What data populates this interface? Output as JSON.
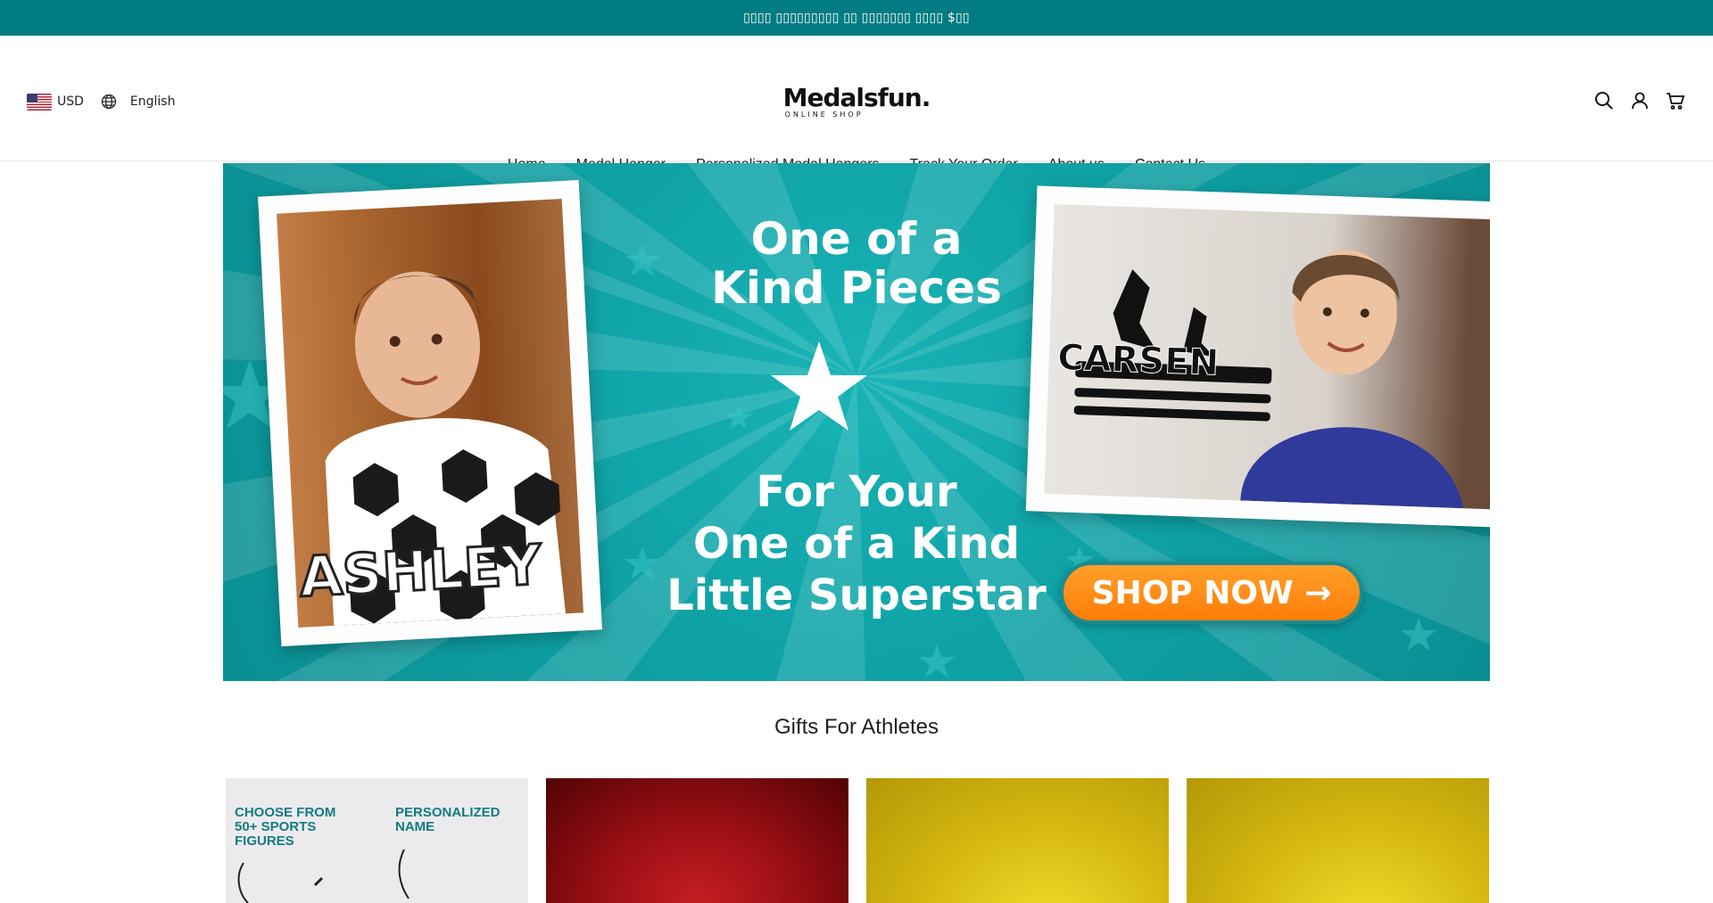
{
  "announcement": {
    "text": "▯▯▯▯ ▯▯▯▯▯▯▯▯▯ ▯▯ ▯▯▯▯▯▯▯ ▯▯▯▯ $▯▯"
  },
  "header": {
    "currency": "USD",
    "language": "English",
    "logo_main": "Medalsfun.",
    "logo_sub": "ONLINE SHOP",
    "icons": [
      "search-icon",
      "account-icon",
      "cart-icon"
    ]
  },
  "nav": {
    "items": [
      {
        "label": "Home"
      },
      {
        "label": "Medal Hanger"
      },
      {
        "label": "Personalized Medal Hangers"
      },
      {
        "label": "Track Your Order"
      },
      {
        "label": "About us"
      },
      {
        "label": "Contact Us"
      }
    ]
  },
  "hero": {
    "title_line1": "One of a",
    "title_line2": "Kind Pieces",
    "sub_line1": "For Your",
    "sub_line2": "One of a Kind",
    "sub_line3": "Little Superstar",
    "left_photo_name": "ASHLEY",
    "right_photo_name": "CARSEN",
    "cta_label": "SHOP NOW →",
    "colors": {
      "background": "#0fa3a6",
      "cta": "#ff8a12"
    }
  },
  "section": {
    "title": "Gifts For Athletes",
    "cards": [
      {
        "label_left": "CHOOSE FROM\n50+ SPORTS\nFIGURES",
        "label_right": "PERSONALIZED\nNAME"
      },
      {
        "label_left": "",
        "label_right": ""
      },
      {
        "label_left": "",
        "label_right": ""
      },
      {
        "label_left": "",
        "label_right": ""
      }
    ]
  },
  "colors": {
    "accent": "#007c82"
  }
}
